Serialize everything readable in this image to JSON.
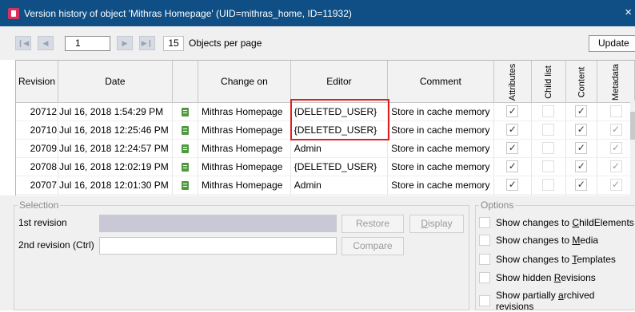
{
  "window": {
    "title": "Version history of object 'Mithras Homepage' (UID=mithras_home, ID=11932)",
    "close_symbol": "×"
  },
  "toolbar": {
    "first_icon": "first-page-icon",
    "prev_icon": "previous-page-icon",
    "next_icon": "next-page-icon",
    "last_icon": "last-page-icon",
    "page_value": "1",
    "per_page_value": "15",
    "per_page_label": "Objects per page",
    "update_label": "Update"
  },
  "table": {
    "columns": [
      "Revision",
      "Date",
      "",
      "Change on",
      "Editor",
      "Comment",
      "Attributes",
      "Child list",
      "Content",
      "Metadata"
    ],
    "rows": [
      {
        "revision": "20712",
        "date": "Jul 16, 2018 1:54:29 PM",
        "change_on": "Mithras Homepage",
        "editor": "{DELETED_USER}",
        "comment": "Store in cache memory",
        "attributes": "✓",
        "child_list": "",
        "content": "✓",
        "metadata": ""
      },
      {
        "revision": "20710",
        "date": "Jul 16, 2018 12:25:46 PM",
        "change_on": "Mithras Homepage",
        "editor": "{DELETED_USER}",
        "comment": "Store in cache memory",
        "attributes": "✓",
        "child_list": "",
        "content": "✓",
        "metadata": "✓"
      },
      {
        "revision": "20709",
        "date": "Jul 16, 2018 12:24:57 PM",
        "change_on": "Mithras Homepage",
        "editor": "Admin",
        "comment": "Store in cache memory",
        "attributes": "✓",
        "child_list": "",
        "content": "✓",
        "metadata": "✓"
      },
      {
        "revision": "20708",
        "date": "Jul 16, 2018 12:02:19 PM",
        "change_on": "Mithras Homepage",
        "editor": "{DELETED_USER}",
        "comment": "Store in cache memory",
        "attributes": "✓",
        "child_list": "",
        "content": "✓",
        "metadata": "✓"
      },
      {
        "revision": "20707",
        "date": "Jul 16, 2018 12:01:30 PM",
        "change_on": "Mithras Homepage",
        "editor": "Admin",
        "comment": "Store in cache memory",
        "attributes": "✓",
        "child_list": "",
        "content": "✓",
        "metadata": "✓"
      }
    ]
  },
  "selection": {
    "legend": "Selection",
    "first_revision_label": "1st revision",
    "second_revision_label": "2nd revision (Ctrl)",
    "restore_label": "Restore",
    "display_label": "Display",
    "compare_label": "Compare"
  },
  "options": {
    "legend": "Options",
    "items": [
      {
        "pre": "Show changes to ",
        "key": "C",
        "post": "hildElements"
      },
      {
        "pre": "Show changes to ",
        "key": "M",
        "post": "edia"
      },
      {
        "pre": "Show changes to ",
        "key": "T",
        "post": "emplates"
      },
      {
        "pre": "Show hidden ",
        "key": "R",
        "post": "evisions"
      },
      {
        "pre": "Show partially ",
        "key": "a",
        "post": "rchived revisions"
      }
    ]
  },
  "colors": {
    "titlebar": "#0f4f86",
    "highlight": "#e02020",
    "doc_icon": "#4f9a3e"
  }
}
